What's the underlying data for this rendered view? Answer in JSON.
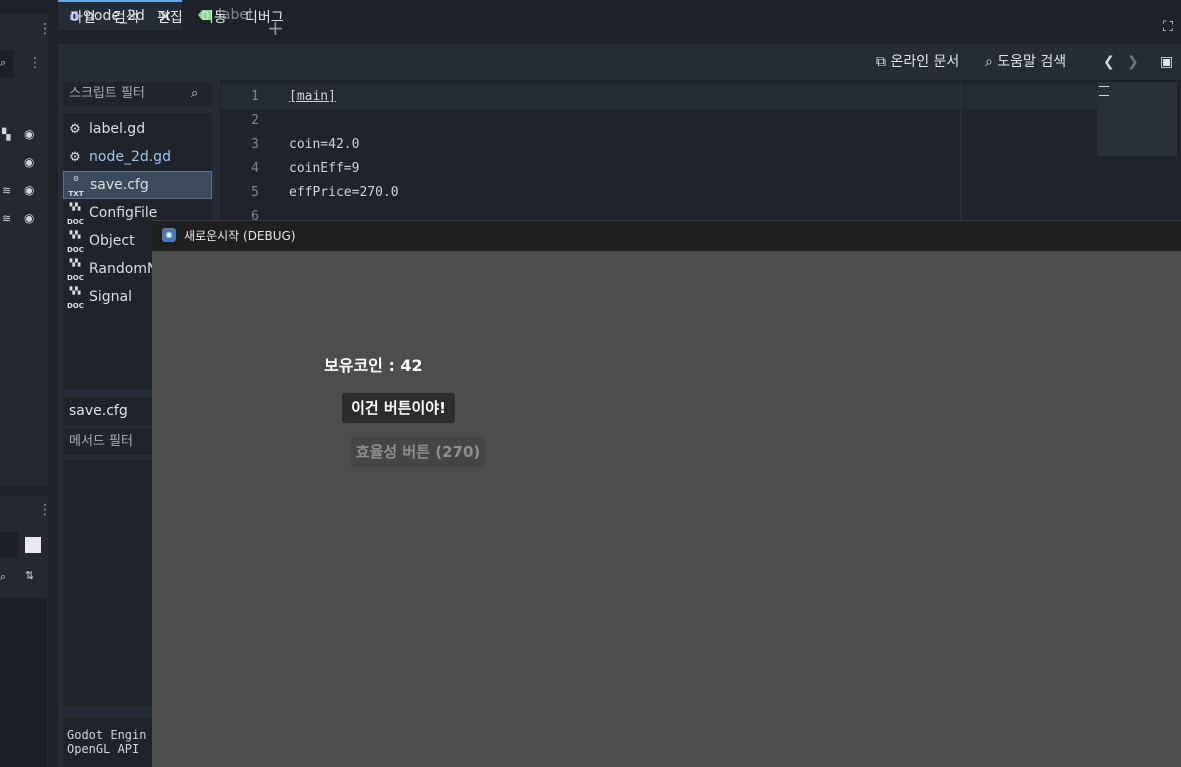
{
  "tabs": [
    {
      "label": "node_2d"
    },
    {
      "label": "label"
    }
  ],
  "menu": [
    "파일",
    "검색",
    "편집",
    "이동",
    "디버그"
  ],
  "toolbar": {
    "online_docs": "온라인 문서",
    "help_search": "도움말 검색"
  },
  "script_filter": {
    "placeholder": "스크립트 필터"
  },
  "files": [
    {
      "name": "label.gd",
      "icon": "gear-icon"
    },
    {
      "name": "node_2d.gd",
      "icon": "gear-icon"
    },
    {
      "name": "save.cfg",
      "icon": "text-file-icon",
      "selected": true
    },
    {
      "name": "ConfigFile",
      "icon": "doc-icon"
    },
    {
      "name": "Object",
      "icon": "doc-icon"
    },
    {
      "name": "RandomN",
      "icon": "doc-icon"
    },
    {
      "name": "Signal",
      "icon": "doc-icon"
    }
  ],
  "current_file": "save.cfg",
  "method_filter": {
    "placeholder": "메서드 필터"
  },
  "log": {
    "line1": "Godot Engin",
    "line2": "OpenGL API"
  },
  "code": [
    {
      "n": "1",
      "text": "[main]"
    },
    {
      "n": "2",
      "text": ""
    },
    {
      "n": "3",
      "text": "coin=42.0"
    },
    {
      "n": "4",
      "text": "coinEff=9"
    },
    {
      "n": "5",
      "text": "effPrice=270.0"
    },
    {
      "n": "6",
      "text": ""
    }
  ],
  "game_window": {
    "title": "새로운시작 (DEBUG)",
    "coin_label": "보유코인 : 42",
    "main_button": "이건 버튼이야!",
    "eff_button": "효율성 버튼 (270)"
  },
  "colors": {
    "accent": "#6aa8e8",
    "game_bg": "#4d4d4d",
    "editor_bg": "#1f242c"
  }
}
